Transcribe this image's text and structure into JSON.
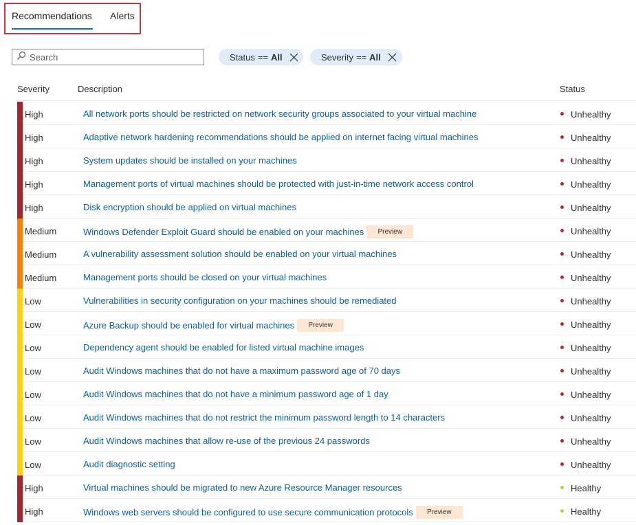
{
  "tabs": [
    {
      "label": "Recommendations",
      "active": true
    },
    {
      "label": "Alerts",
      "active": false
    }
  ],
  "search": {
    "placeholder": "Search",
    "value": ""
  },
  "filters": [
    {
      "key": "Status",
      "op": "==",
      "value": "All"
    },
    {
      "key": "Severity",
      "op": "==",
      "value": "All"
    }
  ],
  "columns": {
    "severity": "Severity",
    "description": "Description",
    "status": "Status"
  },
  "colors": {
    "High": "#a4262c",
    "Medium": "#f7810a",
    "Low": "#fcd116",
    "Unhealthy": "#e81123",
    "Healthy": "#bad80a",
    "link": "#0062ad",
    "accent": "#0078d4",
    "highlight_border": "#d13438",
    "preview_bg": "#fde7d4",
    "filter_bg": "#e0ecf7"
  },
  "preview_label": "Preview",
  "rows": [
    {
      "severity": "High",
      "description": "All network ports should be restricted on network security groups associated to your virtual machine",
      "preview": false,
      "status": "Unhealthy"
    },
    {
      "severity": "High",
      "description": "Adaptive network hardening recommendations should be applied on internet facing virtual machines",
      "preview": false,
      "status": "Unhealthy"
    },
    {
      "severity": "High",
      "description": "System updates should be installed on your machines",
      "preview": false,
      "status": "Unhealthy"
    },
    {
      "severity": "High",
      "description": "Management ports of virtual machines should be protected with just-in-time network access control",
      "preview": false,
      "status": "Unhealthy"
    },
    {
      "severity": "High",
      "description": "Disk encryption should be applied on virtual machines",
      "preview": false,
      "status": "Unhealthy"
    },
    {
      "severity": "Medium",
      "description": "Windows Defender Exploit Guard should be enabled on your machines",
      "preview": true,
      "status": "Unhealthy"
    },
    {
      "severity": "Medium",
      "description": "A vulnerability assessment solution should be enabled on your virtual machines",
      "preview": false,
      "status": "Unhealthy"
    },
    {
      "severity": "Medium",
      "description": "Management ports should be closed on your virtual machines",
      "preview": false,
      "status": "Unhealthy"
    },
    {
      "severity": "Low",
      "description": "Vulnerabilities in security configuration on your machines should be remediated",
      "preview": false,
      "status": "Unhealthy"
    },
    {
      "severity": "Low",
      "description": "Azure Backup should be enabled for virtual machines",
      "preview": true,
      "status": "Unhealthy"
    },
    {
      "severity": "Low",
      "description": "Dependency agent should be enabled for listed virtual machine images",
      "preview": false,
      "status": "Unhealthy"
    },
    {
      "severity": "Low",
      "description": "Audit Windows machines that do not have a maximum password age of 70 days",
      "preview": false,
      "status": "Unhealthy"
    },
    {
      "severity": "Low",
      "description": "Audit Windows machines that do not have a minimum password age of 1 day",
      "preview": false,
      "status": "Unhealthy"
    },
    {
      "severity": "Low",
      "description": "Audit Windows machines that do not restrict the minimum password length to 14 characters",
      "preview": false,
      "status": "Unhealthy"
    },
    {
      "severity": "Low",
      "description": "Audit Windows machines that allow re-use of the previous 24 passwords",
      "preview": false,
      "status": "Unhealthy"
    },
    {
      "severity": "Low",
      "description": "Audit diagnostic setting",
      "preview": false,
      "status": "Unhealthy"
    },
    {
      "severity": "High",
      "description": "Virtual machines should be migrated to new Azure Resource Manager resources",
      "preview": false,
      "status": "Healthy"
    },
    {
      "severity": "High",
      "description": "Windows web servers should be configured to use secure communication protocols",
      "preview": true,
      "status": "Healthy"
    }
  ]
}
